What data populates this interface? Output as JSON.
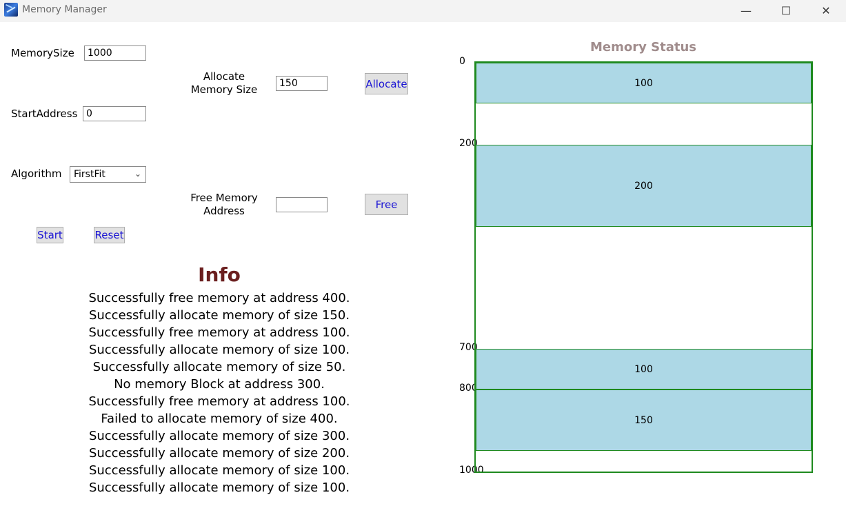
{
  "window": {
    "title": "Memory Manager",
    "minimize": "—",
    "maximize": "☐",
    "close": "✕"
  },
  "controls": {
    "memory_size_label": "MemorySize",
    "memory_size_value": "1000",
    "start_address_label": "StartAddress",
    "start_address_value": "0",
    "algorithm_label": "Algorithm",
    "algorithm_value": "FirstFit",
    "allocate_size_label_line1": "Allocate",
    "allocate_size_label_line2": "Memory Size",
    "allocate_size_value": "150",
    "allocate_button": "Allocate",
    "free_address_label_line1": "Free Memory",
    "free_address_label_line2": "Address",
    "free_address_value": "",
    "free_button": "Free",
    "start_button": "Start",
    "reset_button": "Reset"
  },
  "info": {
    "title": "Info",
    "messages": [
      "Successfully free memory at address 400.",
      "Successfully allocate memory of size 150.",
      "Successfully free memory at address 100.",
      "Successfully allocate memory of size 100.",
      "Successfully allocate memory of size 50.",
      "No memory Block at address 300.",
      "Successfully free memory at address 100.",
      "Failed to allocate memory of size 400.",
      "Successfully allocate memory of size 300.",
      "Successfully allocate memory of size 200.",
      "Successfully allocate memory of size 100.",
      "Successfully allocate memory of size 100."
    ]
  },
  "memory_status": {
    "title": "Memory Status",
    "total": 1000,
    "address_labels": [
      "0",
      "200",
      "700",
      "800",
      "1000"
    ],
    "blocks": [
      {
        "start": 0,
        "size": 100,
        "label": "100"
      },
      {
        "start": 200,
        "size": 200,
        "label": "200"
      },
      {
        "start": 700,
        "size": 100,
        "label": "100"
      },
      {
        "start": 800,
        "size": 150,
        "label": "150"
      }
    ],
    "block_color": "#add8e6",
    "border_color": "#1f8a1f"
  }
}
